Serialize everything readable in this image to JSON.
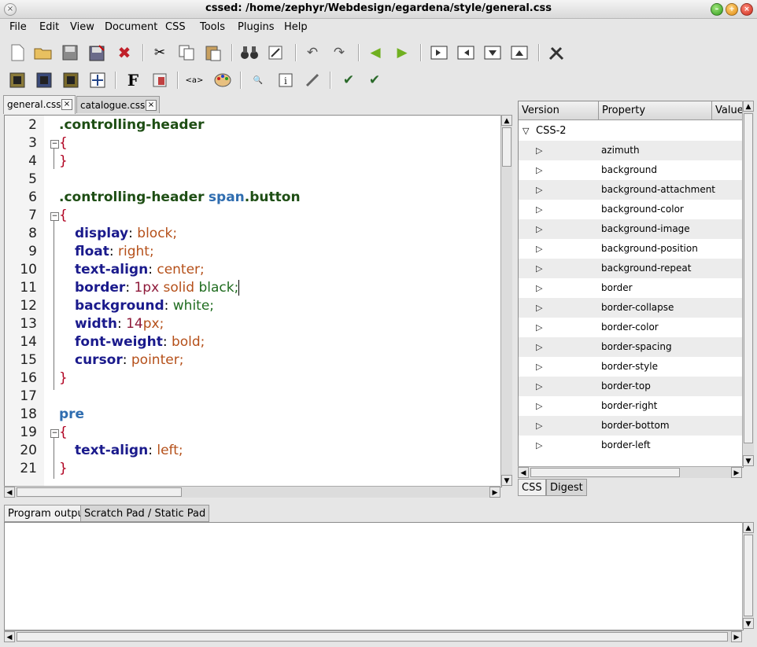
{
  "window": {
    "title": "cssed: /home/zephyr/Webdesign/egardena/style/general.css"
  },
  "menubar": {
    "items": [
      {
        "label": "File"
      },
      {
        "label": "Edit"
      },
      {
        "label": "View"
      },
      {
        "label": "Document"
      },
      {
        "label": "CSS"
      },
      {
        "label": "Tools"
      },
      {
        "label": "Plugins"
      },
      {
        "label": "Help"
      }
    ]
  },
  "editor_tabs": [
    {
      "label": "general.css",
      "close": "×"
    },
    {
      "label": "catalogue.css",
      "close": "×"
    }
  ],
  "code_lines": [
    {
      "n": "2"
    },
    {
      "n": "3"
    },
    {
      "n": "4"
    },
    {
      "n": "5"
    },
    {
      "n": "6"
    },
    {
      "n": "7"
    },
    {
      "n": "8"
    },
    {
      "n": "9"
    },
    {
      "n": "10"
    },
    {
      "n": "11"
    },
    {
      "n": "12"
    },
    {
      "n": "13"
    },
    {
      "n": "14"
    },
    {
      "n": "15"
    },
    {
      "n": "16"
    },
    {
      "n": "17"
    },
    {
      "n": "18"
    },
    {
      "n": "19"
    },
    {
      "n": "20"
    },
    {
      "n": "21"
    }
  ],
  "code": {
    "l2_sel": ".controlling-header",
    "brace_open": "{",
    "brace_close": "}",
    "l6_sel": ".controlling-header",
    "l6_tag": "span",
    "l6_cls": ".button",
    "l8_prop": "display",
    "l8_val": "block;",
    "l9_prop": "float",
    "l9_val": "right;",
    "l10_prop": "text-align",
    "l10_val": "center;",
    "l11_prop": "border",
    "l11_num": "1px",
    "l11_val1": "solid",
    "l11_val2": "black;",
    "l12_prop": "background",
    "l12_val": "white;",
    "l13_prop": "width",
    "l13_num": "14",
    "l13_unit": "px;",
    "l14_prop": "font-weight",
    "l14_val": "bold;",
    "l15_prop": "cursor",
    "l15_val": "pointer;",
    "l18_tag": "pre",
    "l20_prop": "text-align",
    "l20_val": "left;",
    "colon": ": "
  },
  "property_panel": {
    "columns": {
      "version": "Version",
      "property": "Property",
      "value": "Value"
    },
    "group": "CSS-2",
    "properties": [
      "azimuth",
      "background",
      "background-attachment",
      "background-color",
      "background-image",
      "background-position",
      "background-repeat",
      "border",
      "border-collapse",
      "border-color",
      "border-spacing",
      "border-style",
      "border-top",
      "border-right",
      "border-bottom",
      "border-left"
    ],
    "tabs": [
      {
        "label": "CSS"
      },
      {
        "label": "Digest"
      }
    ]
  },
  "output_tabs": [
    {
      "label": "Program output"
    },
    {
      "label": "Scratch Pad / Static Pad"
    }
  ],
  "colors": {
    "selector": "#1e4e14",
    "property": "#1a1a8c",
    "value": "#b5501a",
    "number": "#8e1a3a",
    "brace": "#b00020",
    "tag": "#2f6db0"
  }
}
